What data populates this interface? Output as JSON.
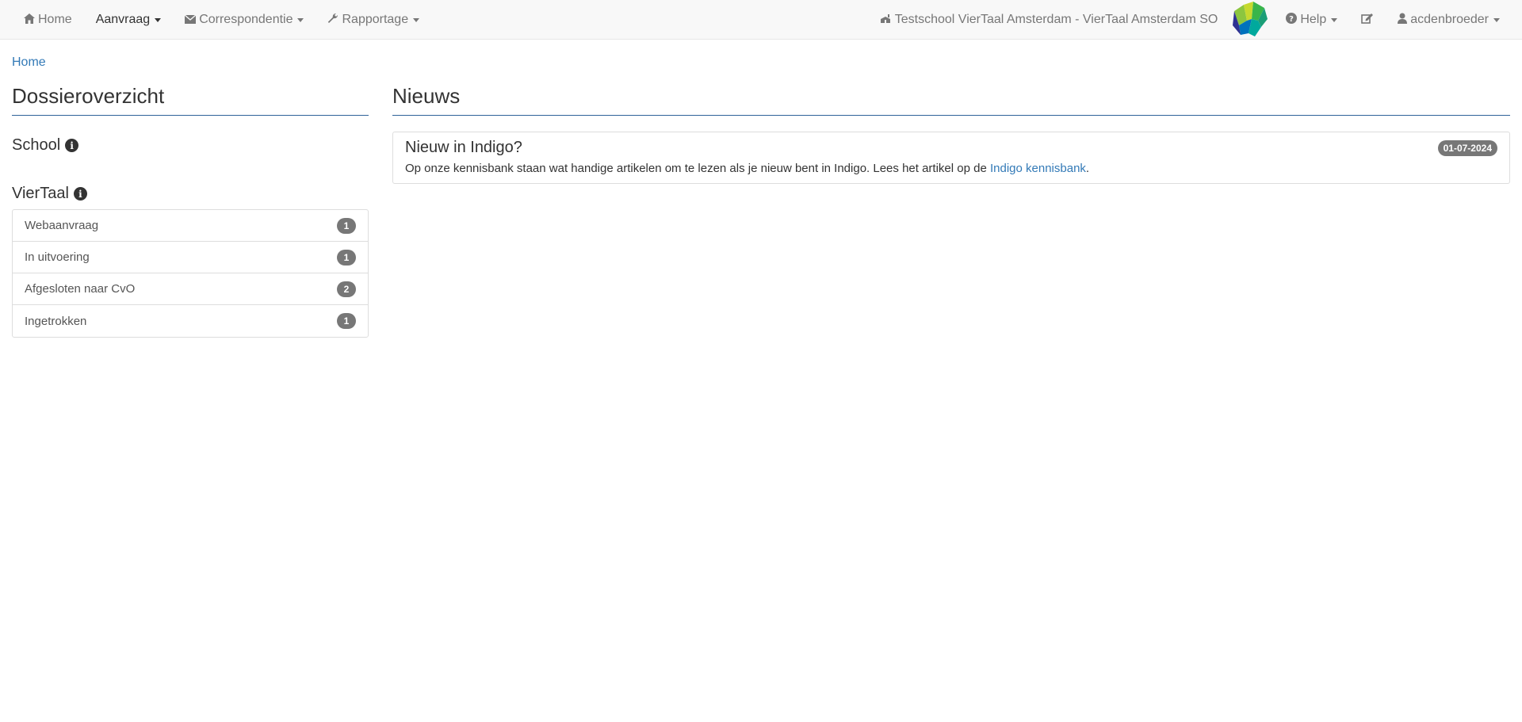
{
  "nav": {
    "home": "Home",
    "aanvraag": "Aanvraag",
    "correspondentie": "Correspondentie",
    "rapportage": "Rapportage",
    "school_name": "Testschool VierTaal Amsterdam - VierTaal Amsterdam SO",
    "help": "Help",
    "user": "acdenbroeder",
    "icons": {
      "home": "home-icon",
      "correspondentie": "envelope-icon",
      "rapportage": "wrench-icon",
      "school": "school-icon",
      "help": "question-circle-icon",
      "edit": "edit-icon",
      "user": "user-icon"
    }
  },
  "breadcrumb": {
    "home": "Home"
  },
  "dossier": {
    "title": "Dossieroverzicht",
    "school_label": "School",
    "viertaal_label": "VierTaal",
    "items": [
      {
        "label": "Webaanvraag",
        "count": "1"
      },
      {
        "label": "In uitvoering",
        "count": "1"
      },
      {
        "label": "Afgesloten naar CvO",
        "count": "2"
      },
      {
        "label": "Ingetrokken",
        "count": "1"
      }
    ]
  },
  "news": {
    "title": "Nieuws",
    "items": [
      {
        "title": "Nieuw in Indigo?",
        "date": "01-07-2024",
        "text": "Op onze kennisbank staan wat handige artikelen om te lezen als je nieuw bent in Indigo. Lees het artikel op de ",
        "link": "Indigo kennisbank",
        "after": "."
      }
    ]
  },
  "colors": {
    "link": "#337ab7",
    "badge": "#777777",
    "rule": "#2e6399",
    "navbar_bg": "#f8f8f8"
  }
}
